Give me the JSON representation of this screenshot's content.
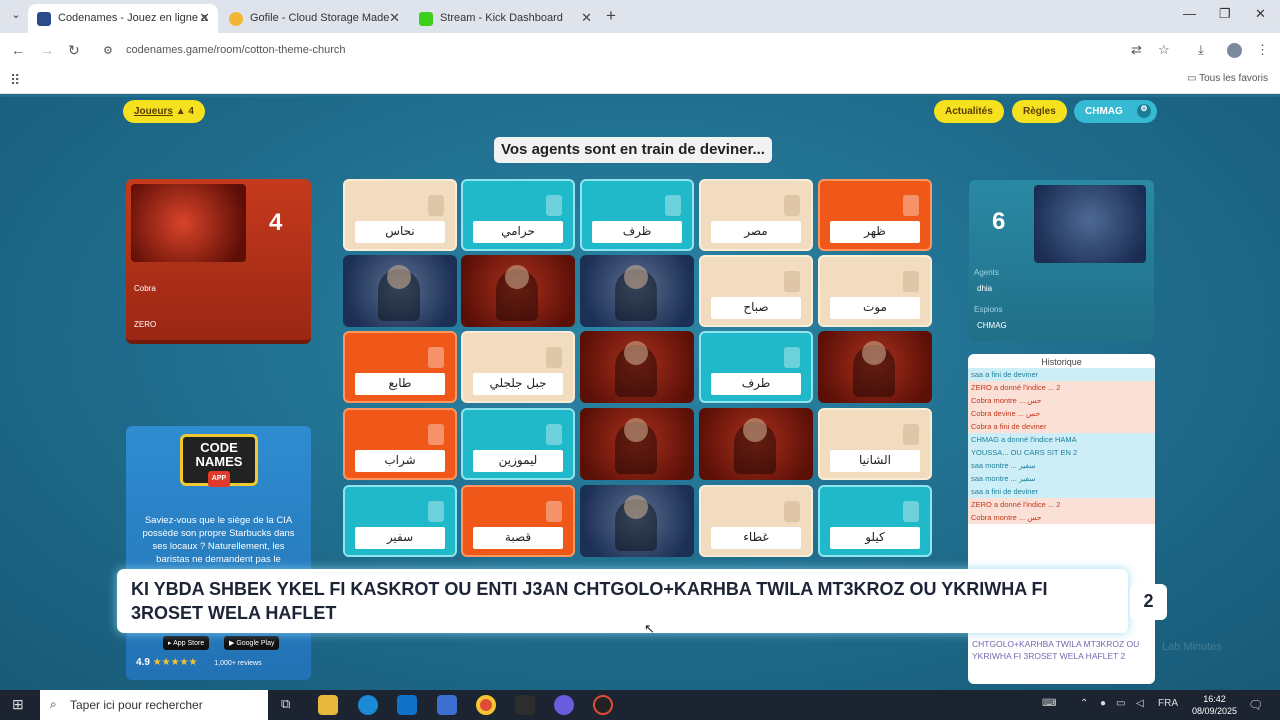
{
  "browser": {
    "tabs": [
      {
        "title": "Codenames - Jouez en ligne a",
        "fav": "#2a4c8a"
      },
      {
        "title": "Gofile - Cloud Storage Made",
        "fav": "#f2b632"
      },
      {
        "title": "Stream - Kick Dashboard",
        "fav": "#3ccf1c"
      }
    ],
    "url": "codenames.game/room/cotton-theme-church",
    "all_bookmarks": "Tous les favoris"
  },
  "game": {
    "players_btn": "Joueurs",
    "players_count": "4",
    "refresh_btn": "Actualités",
    "rules_btn": "Règles",
    "user_btn": "CHMAG",
    "status": "Vos agents sont en train de deviner...",
    "red_team": {
      "score": "4",
      "label_1": "Cobra",
      "label_2": "ZERO"
    },
    "blue_team": {
      "score": "6",
      "label_1": "Agents",
      "player_1": "dhia",
      "label_2": "Espions",
      "player_2": "CHMAG"
    },
    "cards": [
      {
        "word": "نحاس",
        "type": "n"
      },
      {
        "word": "حرامي",
        "type": "c"
      },
      {
        "word": "ظرف",
        "type": "c"
      },
      {
        "word": "مصر",
        "type": "n"
      },
      {
        "word": "ظهر",
        "type": "o"
      },
      {
        "word": "",
        "type": "agent-blue"
      },
      {
        "word": "",
        "type": "agent-red"
      },
      {
        "word": "",
        "type": "agent-blue"
      },
      {
        "word": "صباح",
        "type": "n"
      },
      {
        "word": "موت",
        "type": "n"
      },
      {
        "word": "طابع",
        "type": "o"
      },
      {
        "word": "جبل جلجلي",
        "type": "n"
      },
      {
        "word": "",
        "type": "agent-red"
      },
      {
        "word": "طرف",
        "type": "c"
      },
      {
        "word": "",
        "type": "agent-red"
      },
      {
        "word": "شراب",
        "type": "o"
      },
      {
        "word": "ليموزين",
        "type": "c"
      },
      {
        "word": "",
        "type": "agent-red"
      },
      {
        "word": "",
        "type": "agent-red"
      },
      {
        "word": "الشانيا",
        "type": "n"
      },
      {
        "word": "سفير",
        "type": "c"
      },
      {
        "word": "قصبة",
        "type": "o"
      },
      {
        "word": "",
        "type": "agent-blue"
      },
      {
        "word": "غطاء",
        "type": "n"
      },
      {
        "word": "كيلو",
        "type": "c"
      }
    ],
    "history": {
      "title": "Historique",
      "rows": [
        {
          "text": "saa a fini de deviner",
          "c": "blue"
        },
        {
          "text": "ZERO a donné l'indice ... 2",
          "c": "red"
        },
        {
          "text": "Cobra montre ... حس",
          "c": "red"
        },
        {
          "text": "Cobra devine ... حس",
          "c": "red"
        },
        {
          "text": "Cobra a fini de deviner",
          "c": "red"
        },
        {
          "text": "CHMAG a donné l'indice HAMA",
          "c": "blue"
        },
        {
          "text": "YOUSSA... OU CARS SIT EN 2",
          "c": "blue"
        },
        {
          "text": "saa montre ... سفير",
          "c": "blue"
        },
        {
          "text": "saa montre ... سفير",
          "c": "blue"
        },
        {
          "text": "saa a fini de deviner",
          "c": "blue"
        },
        {
          "text": "ZERO a donné l'indice ... 2",
          "c": "red"
        },
        {
          "text": "Cobra montre ... حس",
          "c": "red"
        }
      ],
      "bottom": "CHTGOLO+KARHBA TWILA MT3KROZ OU YKRIWHA FI 3ROSET WELA HAFLET 2"
    },
    "promo": {
      "logo_line1": "CODE",
      "logo_line2": "NAMES",
      "logo_app": "APP",
      "text": "Saviez-vous que le siège de la CIA possède son propre Starbucks dans ses locaux ? Naturellement, les baristas ne demandent pas le",
      "app_store": "App Store",
      "google_play": "Google Play",
      "rating": "4.9",
      "stars": "★★★★★",
      "count": "1,000+ reviews"
    },
    "overlay_text": "KI YBDA SHBEK YKEL FI KASKROT OU ENTI J3AN CHTGOLO+KARHBA TWILA MT3KROZ OU YKRIWHA FI 3ROSET WELA HAFLET",
    "overlay_num": "2",
    "watermark": "Lab Minutes"
  },
  "taskbar": {
    "search_placeholder": "Taper ici pour rechercher",
    "lang": "FRA",
    "time": "16:42",
    "date": "08/09/2025"
  }
}
